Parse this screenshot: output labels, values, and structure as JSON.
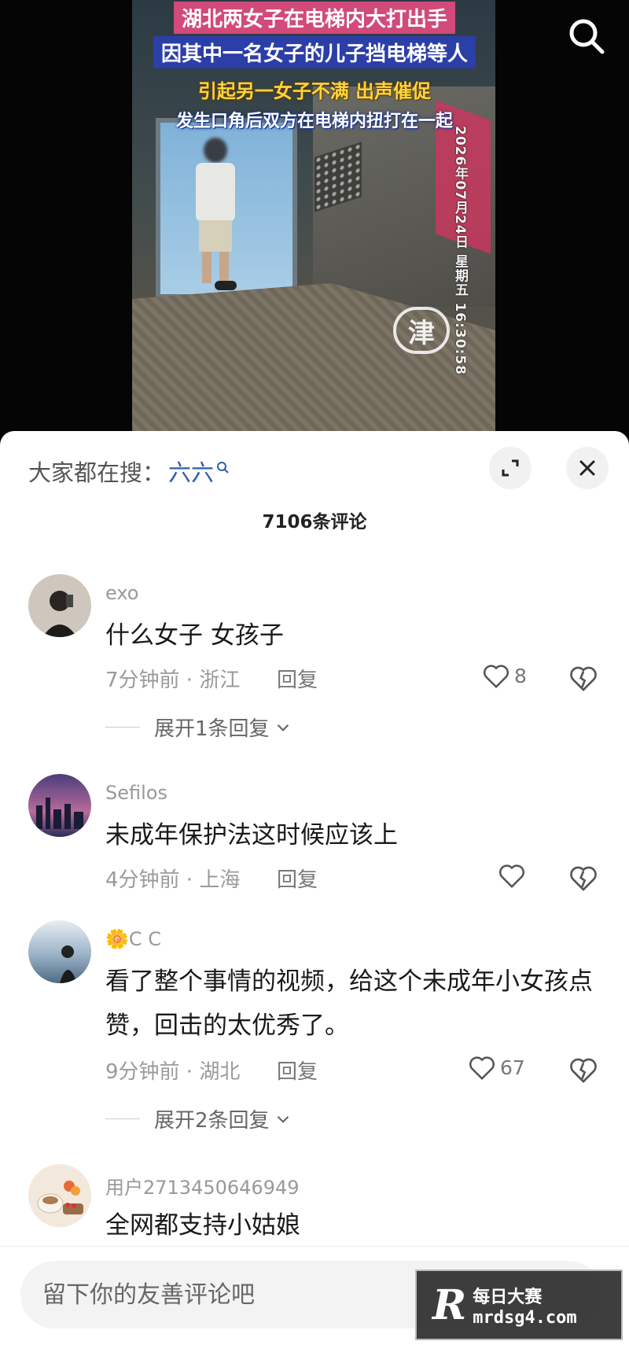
{
  "video": {
    "captions": [
      "湖北两女子在电梯内大打出手",
      "因其中一名女子的儿子挡电梯等人",
      "引起另一女子不满 出声催促",
      "发生口角后双方在电梯内扭打在一起"
    ],
    "timestamp": "2026年07月24日 星期五 16:30:58",
    "watermark_char": "津",
    "search_icon": "search-icon"
  },
  "sheet": {
    "hot_search_label": "大家都在搜：",
    "hot_search_term": "六六",
    "comment_count": "7106条评论"
  },
  "comments": [
    {
      "user": "exo",
      "text": "什么女子 女孩子",
      "time_location": "7分钟前 · 浙江",
      "reply_label": "回复",
      "likes": "8",
      "expand": "展开1条回复"
    },
    {
      "user": "Sefilos",
      "text": "未成年保护法这时候应该上",
      "time_location": "4分钟前 · 上海",
      "reply_label": "回复",
      "likes": ""
    },
    {
      "user_prefix": "🌼",
      "user": "C C",
      "text": "看了整个事情的视频，给这个未成年小女孩点赞，回击的太优秀了。",
      "time_location": "9分钟前 · 湖北",
      "reply_label": "回复",
      "likes": "67",
      "expand": "展开2条回复"
    },
    {
      "user": "用户2713450646949",
      "text": "全网都支持小姑娘"
    }
  ],
  "input": {
    "placeholder": "留下你的友善评论吧"
  },
  "brand": {
    "logo": "R",
    "name": "每日大赛",
    "url": "mrdsg4.com"
  },
  "colors": {
    "hot_search_term": "#2d5fa8",
    "caption_pink": "#d14a7a",
    "caption_blue": "#2c3ea8",
    "caption_yellow": "#ffd43b"
  }
}
